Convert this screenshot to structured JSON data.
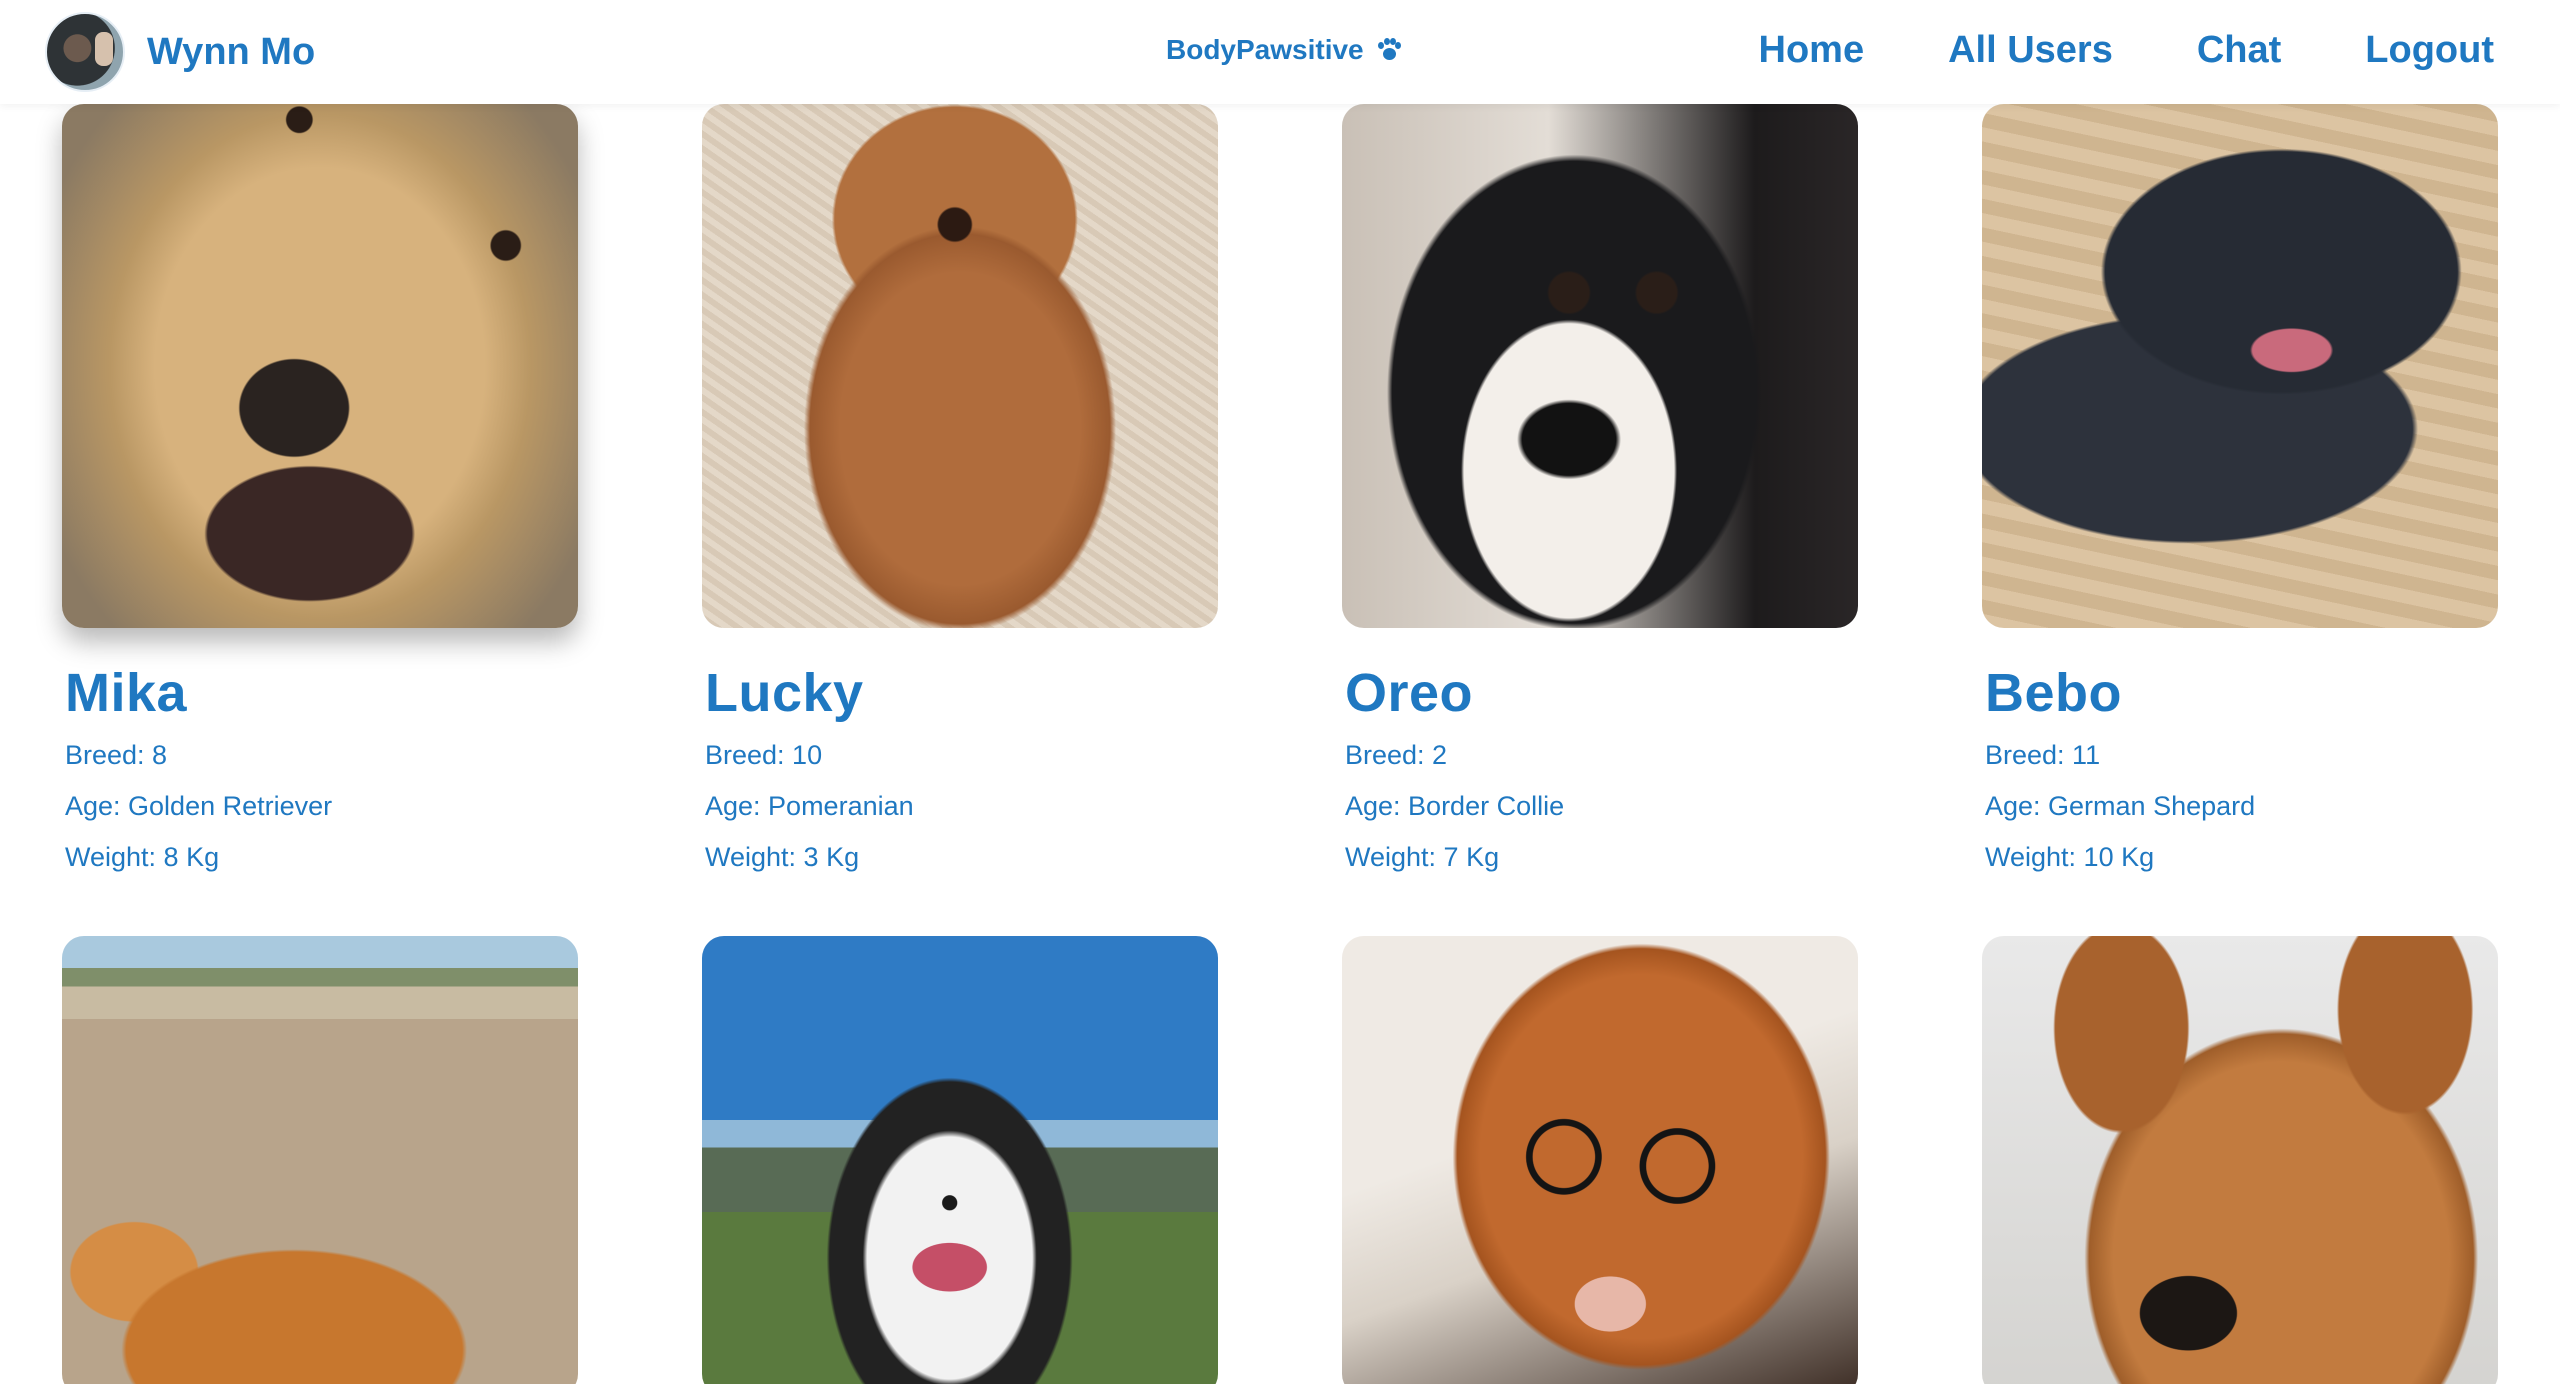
{
  "header": {
    "username": "Wynn Mo",
    "brand": "BodyPawsitive",
    "brand_icon": "paw-icon",
    "nav": [
      "Home",
      "All Users",
      "Chat",
      "Logout"
    ]
  },
  "colors": {
    "accent": "#1f78c1",
    "background": "#ffffff"
  },
  "dogs": [
    {
      "name": "Mika",
      "breed_line": "Breed: 8",
      "age_line": "Age: Golden Retriever",
      "weight_line": "Weight: 8 Kg"
    },
    {
      "name": "Lucky",
      "breed_line": "Breed: 10",
      "age_line": "Age: Pomeranian",
      "weight_line": "Weight: 3 Kg"
    },
    {
      "name": "Oreo",
      "breed_line": "Breed: 2",
      "age_line": "Age: Border Collie",
      "weight_line": "Weight: 7 Kg"
    },
    {
      "name": "Bebo",
      "breed_line": "Breed: 11",
      "age_line": "Age: German Shepard",
      "weight_line": "Weight: 10 Kg"
    }
  ]
}
